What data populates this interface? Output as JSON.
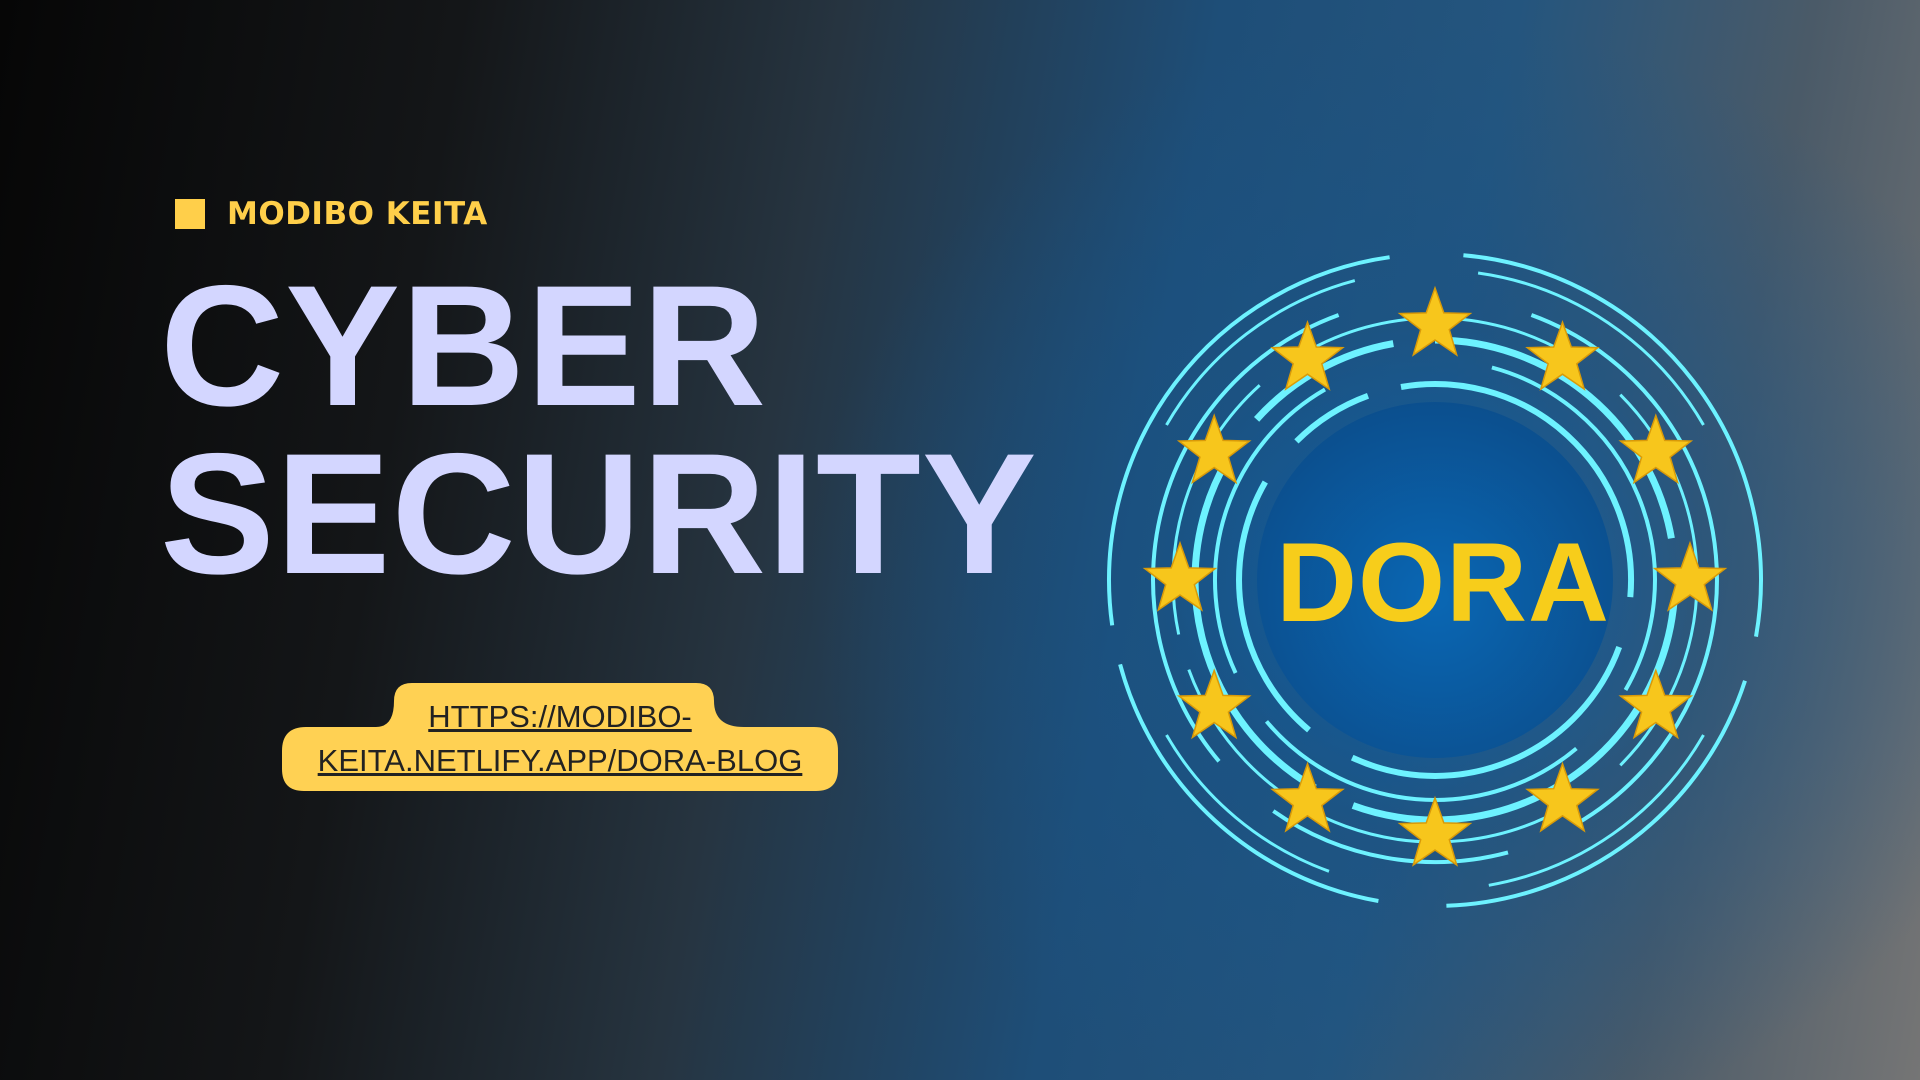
{
  "author": {
    "name": "MODIBO KEITA"
  },
  "headline": {
    "line1": "CYBER",
    "line2": "SECURITY"
  },
  "link": {
    "line1": "HTTPS://MODIBO-",
    "line2": "KEITA.NETLIFY.APP/DORA-BLOG"
  },
  "emblem": {
    "label": "DORA",
    "star_count": 12,
    "icon": "eu-stars-circuit-emblem"
  },
  "colors": {
    "accent_yellow": "#ffcf4a",
    "headline": "#d3d6ff",
    "ring_cyan": "#6df2ff",
    "star_gold": "#f7c61c",
    "disc_blue": "#0a5fa8"
  }
}
